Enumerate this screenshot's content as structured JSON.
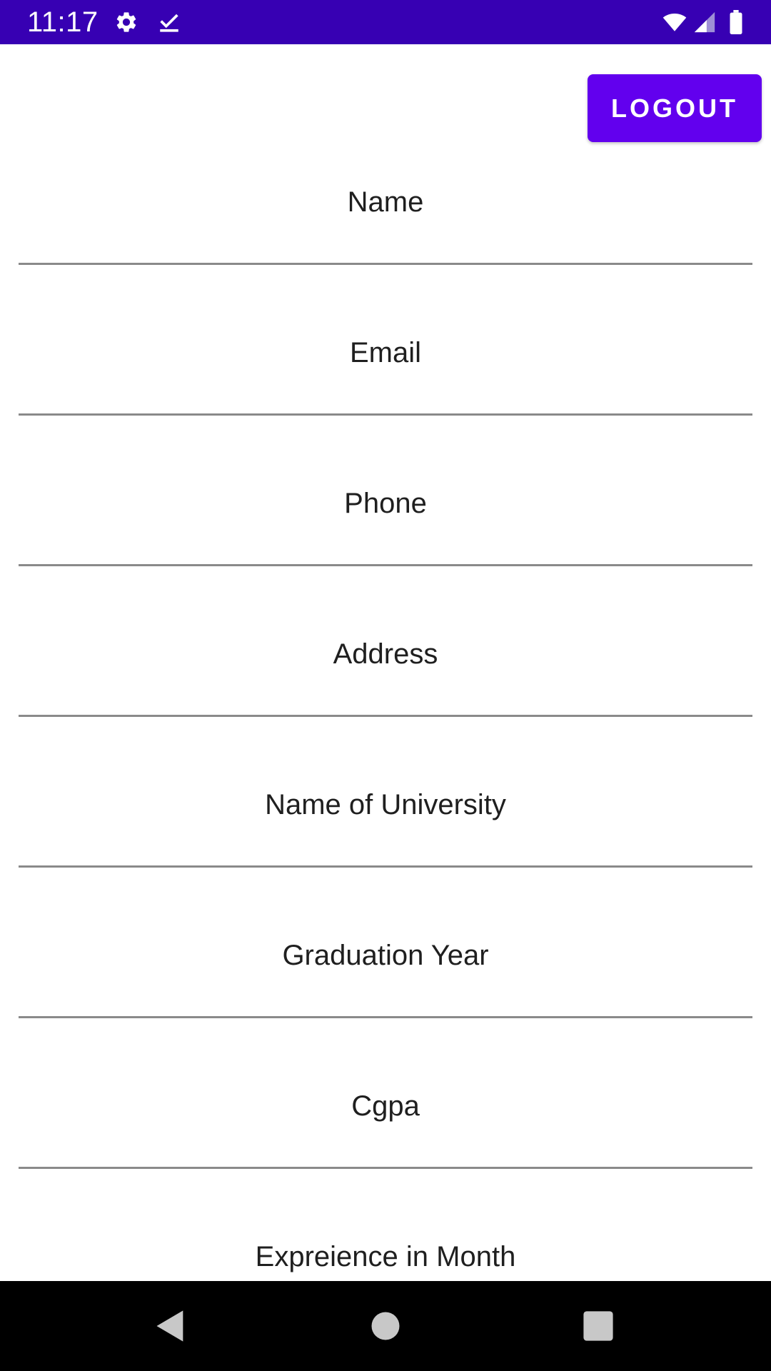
{
  "status_bar": {
    "time": "11:17",
    "icons": [
      "gear-icon",
      "check-download-icon",
      "wifi-icon",
      "signal-icon",
      "battery-icon"
    ],
    "background": "#3700b3"
  },
  "toolbar": {
    "logout_label": "LOGOUT",
    "accent": "#6200ee"
  },
  "form": {
    "fields": [
      {
        "placeholder": "Name"
      },
      {
        "placeholder": "Email"
      },
      {
        "placeholder": "Phone"
      },
      {
        "placeholder": "Address"
      },
      {
        "placeholder": "Name of University"
      },
      {
        "placeholder": "Graduation Year"
      },
      {
        "placeholder": "Cgpa"
      },
      {
        "placeholder": "Expreience in Month"
      }
    ]
  },
  "nav_bar": {
    "buttons": [
      "back-icon",
      "home-icon",
      "recents-icon"
    ]
  }
}
